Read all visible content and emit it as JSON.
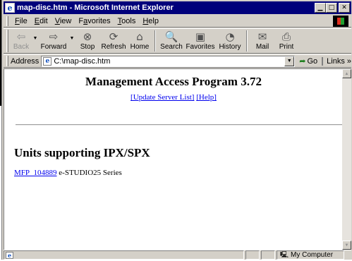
{
  "window": {
    "title": "map-disc.htm - Microsoft Internet Explorer",
    "min_glyph": "▁",
    "max_glyph": "□",
    "close_glyph": "✕"
  },
  "menu": [
    {
      "key": "F",
      "rest": "ile"
    },
    {
      "key": "E",
      "rest": "dit"
    },
    {
      "key": "V",
      "rest": "iew"
    },
    {
      "key": "a",
      "pre": "F",
      "rest": "vorites"
    },
    {
      "key": "T",
      "rest": "ools"
    },
    {
      "key": "H",
      "rest": "elp"
    }
  ],
  "menu_labels": [
    "File",
    "Edit",
    "View",
    "Favorites",
    "Tools",
    "Help"
  ],
  "toolbar": {
    "back": "Back",
    "forward": "Forward",
    "stop": "Stop",
    "refresh": "Refresh",
    "home": "Home",
    "search": "Search",
    "favorites": "Favorites",
    "history": "History",
    "mail": "Mail",
    "print": "Print"
  },
  "icons": {
    "back": "⇦",
    "forward": "⇨",
    "stop": "⊗",
    "refresh": "⟳",
    "home": "⌂",
    "search": "🔍",
    "favorites": "▣",
    "history": "◔",
    "mail": "✉",
    "print": "⎙"
  },
  "address": {
    "label": "Address",
    "value": "C:\\map-disc.htm",
    "go": "Go",
    "links": "Links »"
  },
  "page": {
    "title": "Management Access Program 3.72",
    "link_update": "[Update Server List]",
    "link_help": "[Help]",
    "section_heading": "Units supporting IPX/SPX",
    "device_link": "MFP_104889",
    "device_desc": " e-STUDIO25 Series"
  },
  "status": {
    "zone": "My Computer"
  },
  "colors": {
    "titlebar": "#00007b",
    "chrome": "#d4d0c8",
    "link": "#0000ee"
  }
}
